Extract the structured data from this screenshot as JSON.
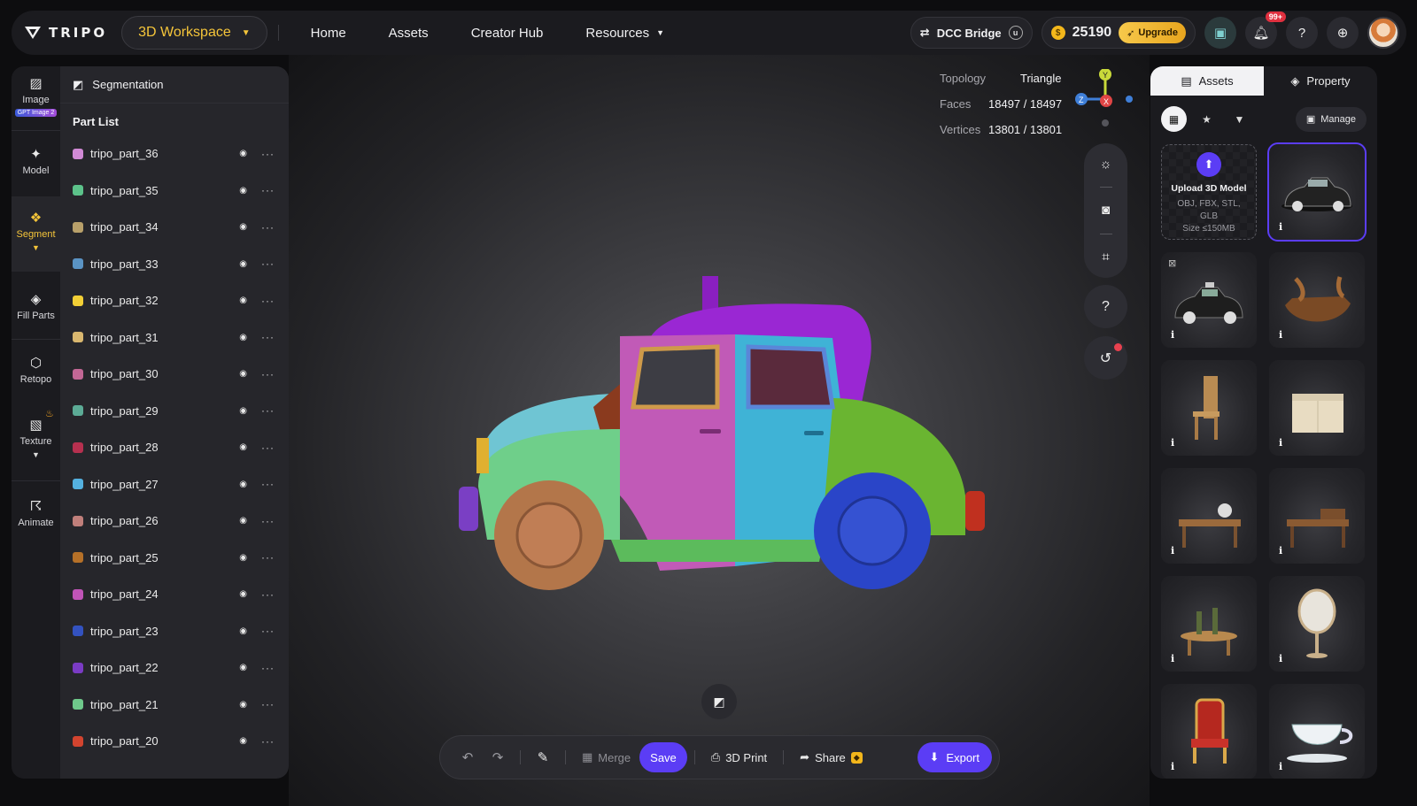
{
  "brand": {
    "name": "TRIPO"
  },
  "header": {
    "workspace_label": "3D Workspace",
    "nav": [
      "Home",
      "Assets",
      "Creator Hub",
      "Resources"
    ],
    "dcc_label": "DCC Bridge",
    "credits": "25190",
    "upgrade_label": "Upgrade",
    "notifications_badge": "99+"
  },
  "rail": {
    "items": [
      {
        "label": "Image",
        "badge": "GPT Image 2",
        "icon": "image-icon"
      },
      {
        "label": "Model",
        "icon": "sparkle-icon"
      },
      {
        "label": "Segment",
        "icon": "segment-icon"
      },
      {
        "label": "Fill Parts",
        "icon": "fill-parts-icon"
      },
      {
        "label": "Retopo",
        "icon": "retopo-icon"
      },
      {
        "label": "Texture",
        "icon": "texture-icon"
      },
      {
        "label": "Animate",
        "icon": "animate-icon"
      }
    ]
  },
  "panel": {
    "title": "Segmentation",
    "subtitle": "Part List",
    "parts": [
      {
        "name": "tripo_part_36",
        "color": "#d18ad6"
      },
      {
        "name": "tripo_part_35",
        "color": "#5cc28a"
      },
      {
        "name": "tripo_part_34",
        "color": "#b8a06a"
      },
      {
        "name": "tripo_part_33",
        "color": "#5a93c4"
      },
      {
        "name": "tripo_part_32",
        "color": "#f2cf36"
      },
      {
        "name": "tripo_part_31",
        "color": "#d9b76f"
      },
      {
        "name": "tripo_part_30",
        "color": "#c26795"
      },
      {
        "name": "tripo_part_29",
        "color": "#5cab96"
      },
      {
        "name": "tripo_part_28",
        "color": "#b6304f"
      },
      {
        "name": "tripo_part_27",
        "color": "#54b1e0"
      },
      {
        "name": "tripo_part_26",
        "color": "#c07f7b"
      },
      {
        "name": "tripo_part_25",
        "color": "#b57028"
      },
      {
        "name": "tripo_part_24",
        "color": "#c054b7"
      },
      {
        "name": "tripo_part_23",
        "color": "#3352c0"
      },
      {
        "name": "tripo_part_22",
        "color": "#7a3bc4"
      },
      {
        "name": "tripo_part_21",
        "color": "#6fc98b"
      },
      {
        "name": "tripo_part_20",
        "color": "#d2442f"
      }
    ]
  },
  "stats": {
    "topology_label": "Topology",
    "topology_value": "Triangle",
    "faces_label": "Faces",
    "faces_value": "18497 / 18497",
    "vertices_label": "Vertices",
    "vertices_value": "13801 / 13801"
  },
  "toolbar": {
    "merge_label": "Merge",
    "save_label": "Save",
    "print_label": "3D Print",
    "share_label": "Share",
    "export_label": "Export"
  },
  "assets": {
    "tab_assets": "Assets",
    "tab_property": "Property",
    "manage_label": "Manage",
    "upload_title": "Upload 3D Model",
    "upload_formats": "OBJ, FBX, STL, GLB",
    "upload_size": "Size ≤150MB",
    "items": [
      "car-black",
      "taxi-black",
      "wooden-boat",
      "wooden-chair",
      "white-chest",
      "desk-with-globe",
      "writing-desk",
      "table-with-bottles",
      "standing-mirror",
      "red-throne-chair",
      "teacup"
    ]
  }
}
